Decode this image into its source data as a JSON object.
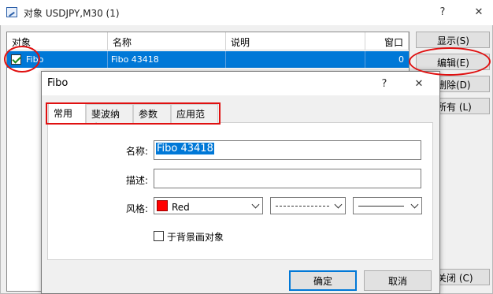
{
  "outer_window": {
    "title": "对象 USDJPY,M30 (1)",
    "help_label": "?",
    "close_label": "✕"
  },
  "table": {
    "columns": [
      "对象",
      "名称",
      "说明",
      "窗口"
    ],
    "rows": [
      {
        "object": "Fibo",
        "name": "Fibo 43418",
        "description": "",
        "window": "0",
        "checked": true
      }
    ]
  },
  "side_buttons": {
    "show": "显示(S)",
    "edit": "编辑(E)",
    "delete": "删除(D)",
    "all": "所有 (L)",
    "close": "关闭 (C)"
  },
  "dialog": {
    "title": "Fibo",
    "help_label": "?",
    "close_label": "✕",
    "tabs": [
      "常用",
      "斐波纳奇",
      "参数",
      "应用范围"
    ],
    "active_tab": "常用",
    "name_label": "名称:",
    "name_value": "Fibo 43418",
    "desc_label": "描述:",
    "desc_value": "",
    "style_label": "风格:",
    "color_value": "Red",
    "color_hex": "#ff0000",
    "background_label": "于背景画对象",
    "background_checked": false,
    "ok_label": "确定",
    "cancel_label": "取消"
  },
  "annotation_color": "#e01010"
}
